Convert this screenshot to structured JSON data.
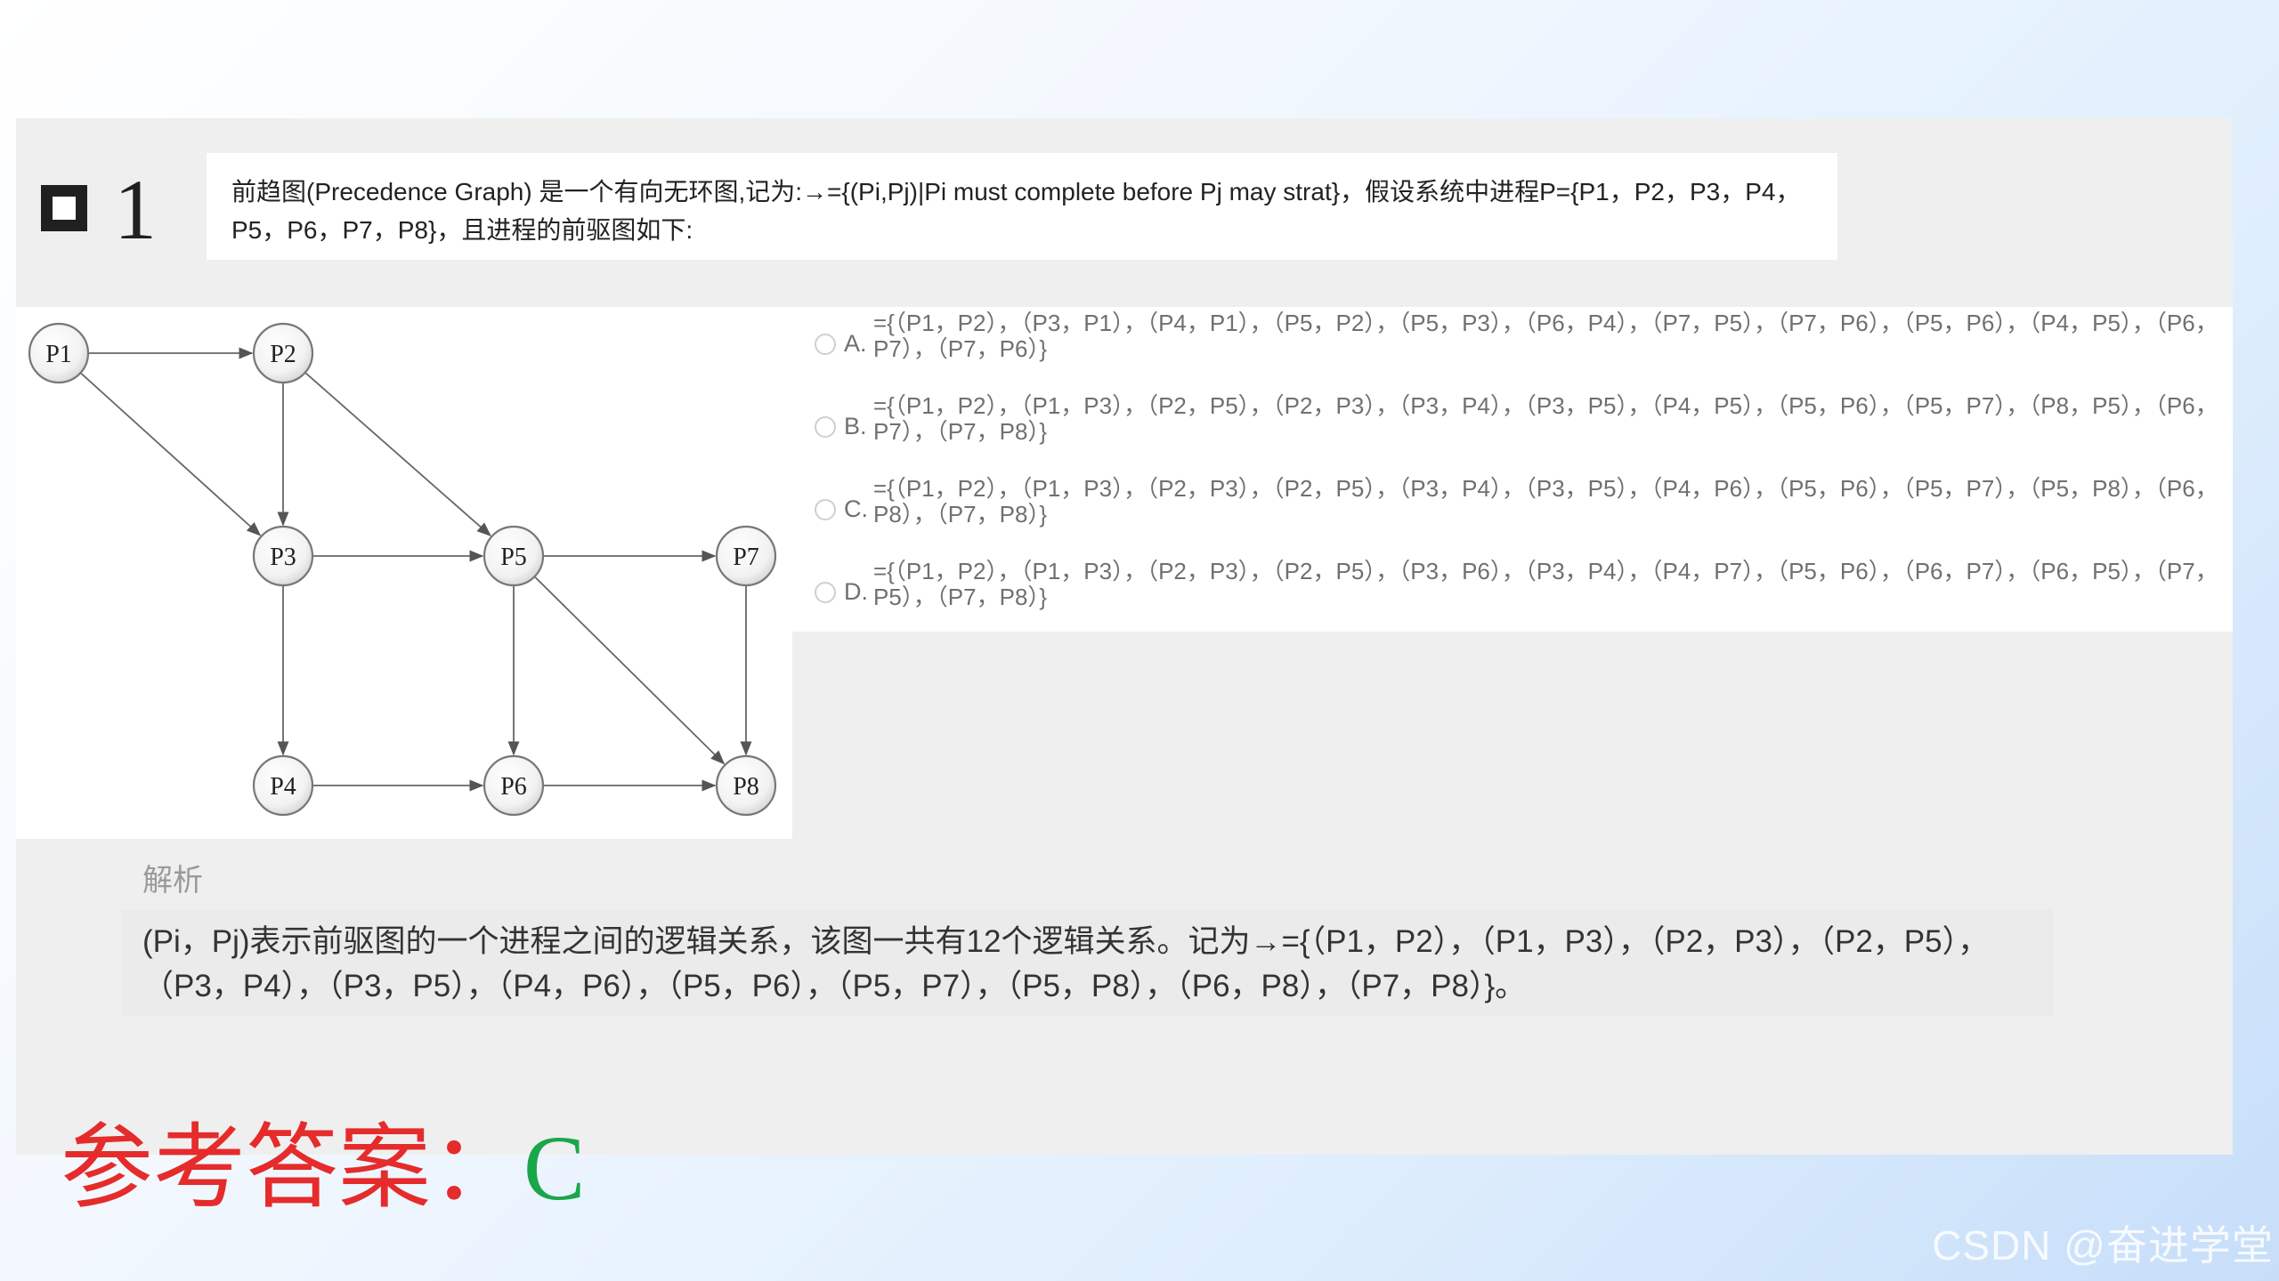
{
  "question": {
    "number": "1",
    "text": "前趋图(Precedence Graph) 是一个有向无环图,记为:→={(Pi,Pj)|Pi must complete before Pj may strat}，假设系统中进程P={P1，P2，P3，P4，P5，P6，P7，P8}，且进程的前驱图如下:"
  },
  "graph": {
    "nodes": [
      "P1",
      "P2",
      "P3",
      "P4",
      "P5",
      "P6",
      "P7",
      "P8"
    ],
    "edges": [
      [
        "P1",
        "P2"
      ],
      [
        "P1",
        "P3"
      ],
      [
        "P2",
        "P3"
      ],
      [
        "P2",
        "P5"
      ],
      [
        "P3",
        "P4"
      ],
      [
        "P3",
        "P5"
      ],
      [
        "P4",
        "P6"
      ],
      [
        "P5",
        "P6"
      ],
      [
        "P5",
        "P7"
      ],
      [
        "P5",
        "P8"
      ],
      [
        "P6",
        "P8"
      ],
      [
        "P7",
        "P8"
      ]
    ]
  },
  "options": [
    {
      "letter": "A.",
      "text": "={（P1，P2），（P3，P1），（P4，P1），（P5，P2），（P5，P3），（P6，P4），（P7，P5），（P7，P6），（P5，P6），（P4，P5），（P6，P7），（P7，P6）}"
    },
    {
      "letter": "B.",
      "text": "={（P1，P2），（P1，P3），（P2，P5），（P2，P3），（P3，P4），（P3，P5），（P4，P5），（P5，P6），（P5，P7），（P8，P5），（P6，P7），（P7，P8）}"
    },
    {
      "letter": "C.",
      "text": "={（P1，P2），（P1，P3），（P2，P3），（P2，P5），（P3，P4），（P3，P5），（P4，P6），（P5，P6），（P5，P7），（P5，P8），（P6，P8），（P7，P8）}"
    },
    {
      "letter": "D.",
      "text": "={（P1，P2），（P1，P3），（P2，P3），（P2，P5），（P3，P6），（P3，P4），（P4，P7），（P5，P6），（P6，P7），（P6，P5），（P7，P5），（P7，P8）}"
    }
  ],
  "analysis": {
    "label": "解析",
    "text": "(Pi，Pj)表示前驱图的一个进程之间的逻辑关系，该图一共有12个逻辑关系。记为→={（P1，P2），（P1，P3），（P2，P3），（P2，P5），（P3，P4），（P3，P5），（P4，P6），（P5，P6），（P5，P7），（P5，P8），（P6，P8），（P7，P8）}。"
  },
  "answer": {
    "label": "参考答案：",
    "value": "C"
  },
  "watermark": "CSDN @奋进学堂"
}
